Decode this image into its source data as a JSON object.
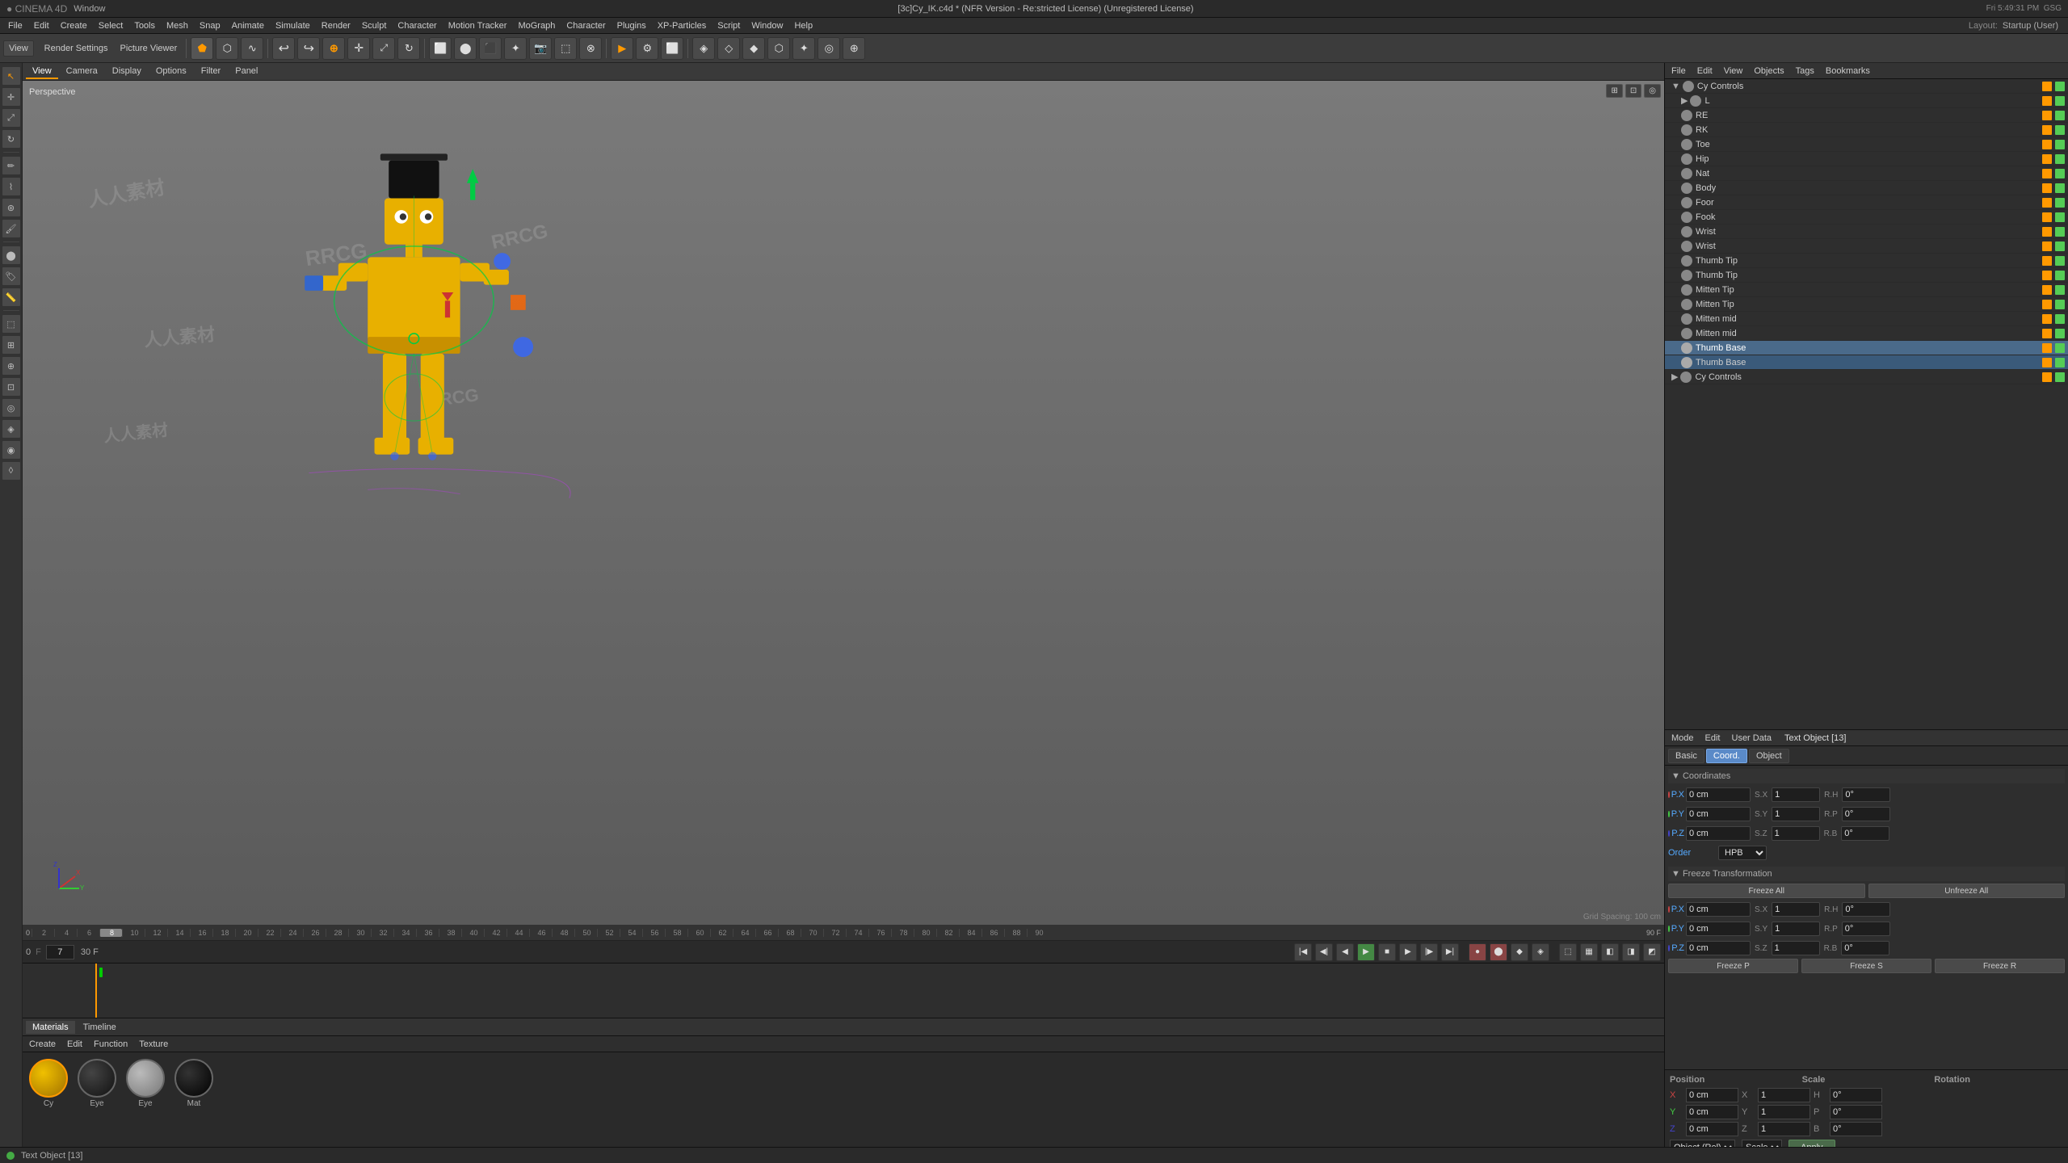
{
  "app": {
    "name": "CINEMA 4D",
    "window_menu": "Window",
    "file_title": "[3c]Cy_IK.c4d * (NFR Version - Re:stricted License) (Unregistered License)",
    "time": "Fri 5:49:31 PM",
    "user": "GSG"
  },
  "menu": {
    "items": [
      "File",
      "Edit",
      "Create",
      "Select",
      "Tools",
      "Mesh",
      "Snap",
      "Animate",
      "Simulate",
      "Render",
      "Sculpt",
      "Character",
      "Motion Tracker",
      "MoGraph",
      "Character",
      "Plugins",
      "XP-Particles",
      "Script",
      "Window",
      "Help"
    ]
  },
  "viewport": {
    "label": "Perspective",
    "tabs": [
      "View",
      "Camera",
      "Display",
      "Options",
      "Filter",
      "Panel"
    ],
    "tab_bar": [
      "View",
      "Render Settings",
      "Picture Viewer"
    ],
    "grid_spacing": "Grid Spacing: 100 cm"
  },
  "layout": {
    "label": "Layout:",
    "current": "Startup (User)"
  },
  "object_manager": {
    "header_tabs": [
      "File",
      "Edit",
      "View",
      "Objects",
      "Tags",
      "Bookmarks"
    ],
    "objects": [
      {
        "name": "Cy Controls",
        "type": "null",
        "indent": 0,
        "selected": false
      },
      {
        "name": "L",
        "type": "null",
        "indent": 1,
        "selected": false
      },
      {
        "name": "RE",
        "type": "null",
        "indent": 1,
        "selected": false
      },
      {
        "name": "RK",
        "type": "null",
        "indent": 1,
        "selected": false
      },
      {
        "name": "Toe",
        "type": "null",
        "indent": 1,
        "selected": false
      },
      {
        "name": "Hip",
        "type": "null",
        "indent": 1,
        "selected": false
      },
      {
        "name": "Nat",
        "type": "null",
        "indent": 1,
        "selected": false
      },
      {
        "name": "Body",
        "type": "null",
        "indent": 1,
        "selected": false
      },
      {
        "name": "Foor",
        "type": "null",
        "indent": 1,
        "selected": false
      },
      {
        "name": "Fook",
        "type": "null",
        "indent": 1,
        "selected": false
      },
      {
        "name": "Wrist",
        "type": "null",
        "indent": 1,
        "selected": false
      },
      {
        "name": "Wrist",
        "type": "null",
        "indent": 1,
        "selected": false
      },
      {
        "name": "Thumb Tip",
        "type": "null",
        "indent": 1,
        "selected": false
      },
      {
        "name": "Thumb Tip",
        "type": "null",
        "indent": 1,
        "selected": false
      },
      {
        "name": "Mitten Tip",
        "type": "null",
        "indent": 1,
        "selected": false
      },
      {
        "name": "Mitten Tip",
        "type": "null",
        "indent": 1,
        "selected": false
      },
      {
        "name": "Mitten mid",
        "type": "null",
        "indent": 1,
        "selected": false
      },
      {
        "name": "Mitten mid",
        "type": "null",
        "indent": 1,
        "selected": false
      },
      {
        "name": "Thumb Base",
        "type": "null",
        "indent": 1,
        "selected": true
      },
      {
        "name": "Thumb Base",
        "type": "null",
        "indent": 1,
        "selected": true
      },
      {
        "name": "Cy Controls",
        "type": "null",
        "indent": 0,
        "selected": false
      }
    ]
  },
  "attr_manager": {
    "header_tabs": [
      "Mode",
      "Edit",
      "User Data"
    ],
    "object_title": "Text Object [13]",
    "tabs": [
      "Basic",
      "Coord.",
      "Object"
    ],
    "active_tab": "Coord.",
    "sections": {
      "coordinates": {
        "title": "Coordinates",
        "rows": [
          {
            "axis": "P.X",
            "val": "0 cm",
            "s_label": "S.X",
            "s_val": "1",
            "r_label": "R.H",
            "r_val": "0°"
          },
          {
            "axis": "P.Y",
            "val": "0 cm",
            "s_label": "S.Y",
            "s_val": "1",
            "r_label": "R.P",
            "r_val": "0°"
          },
          {
            "axis": "P.Z",
            "val": "0 cm",
            "s_label": "S.Z",
            "s_val": "1",
            "r_label": "R.B",
            "r_val": "0°"
          }
        ],
        "order_label": "Order",
        "order_val": "HPB"
      },
      "freeze": {
        "title": "Freeze Transformation",
        "freeze_all": "Freeze All",
        "unfreeze_all": "Unfreeze All",
        "rows": [
          {
            "axis": "P.X",
            "val": "0 cm",
            "s_label": "S.X",
            "s_val": "1",
            "r_label": "R.H",
            "r_val": "0°"
          },
          {
            "axis": "P.Y",
            "val": "0 cm",
            "s_label": "S.Y",
            "s_val": "1",
            "r_label": "R.P",
            "r_val": "0°"
          },
          {
            "axis": "P.Z",
            "val": "0 cm",
            "s_label": "S.Z",
            "s_val": "1",
            "r_label": "R.B",
            "r_val": "0°"
          }
        ],
        "freeze_p": "Freeze P",
        "freeze_s": "Freeze S",
        "freeze_r": "Freeze R"
      }
    }
  },
  "coord_panel": {
    "position_label": "Position",
    "scale_label": "Scale",
    "rotation_label": "Rotation",
    "x_pos": "0 cm",
    "y_pos": "0 cm",
    "z_pos": "0 cm",
    "x_scale": "1",
    "y_scale": "1",
    "z_scale": "1",
    "h_rot": "0°",
    "p_rot": "0°",
    "b_rot": "0°",
    "object_label": "Object (Rel)",
    "scale_dropdown": "Scale",
    "apply_label": "Apply"
  },
  "timeline": {
    "frame_start": "0",
    "frame_end": "90",
    "current_frame": "7",
    "fps": "90 F",
    "fps_rate": "30 F",
    "ticks": [
      "0",
      "2",
      "4",
      "6",
      "8",
      "10",
      "12",
      "14",
      "16",
      "18",
      "20",
      "22",
      "24",
      "26",
      "28",
      "30",
      "32",
      "34",
      "36",
      "38",
      "40",
      "42",
      "44",
      "46",
      "48",
      "50",
      "52",
      "54",
      "56",
      "58",
      "60",
      "62",
      "64",
      "66",
      "68",
      "70",
      "72",
      "74",
      "76",
      "78",
      "80",
      "82",
      "84",
      "86",
      "88",
      "90"
    ]
  },
  "materials": {
    "tabs": [
      "Materials",
      "Timeline"
    ],
    "active_tab": "Materials",
    "toolbar": [
      "Create",
      "Edit",
      "Function",
      "Texture"
    ],
    "items": [
      {
        "name": "Cy",
        "color": "#d4a000",
        "shape": "circle"
      },
      {
        "name": "Eye",
        "color": "#222",
        "shape": "circle"
      },
      {
        "name": "Eye",
        "color": "#999",
        "shape": "circle"
      },
      {
        "name": "Mat",
        "color": "#111",
        "shape": "circle"
      }
    ]
  },
  "status_bar": {
    "text": "Text Object [13]"
  },
  "icons": {
    "play": "▶",
    "stop": "■",
    "rewind": "◀◀",
    "forward": "▶▶",
    "record": "●",
    "prev_frame": "◀",
    "next_frame": "▶",
    "arrow": "→",
    "check": "✓",
    "triangle": "▲",
    "circle": "●",
    "square": "■",
    "gear": "⚙",
    "eye": "👁",
    "lock": "🔒",
    "camera": "📷"
  }
}
